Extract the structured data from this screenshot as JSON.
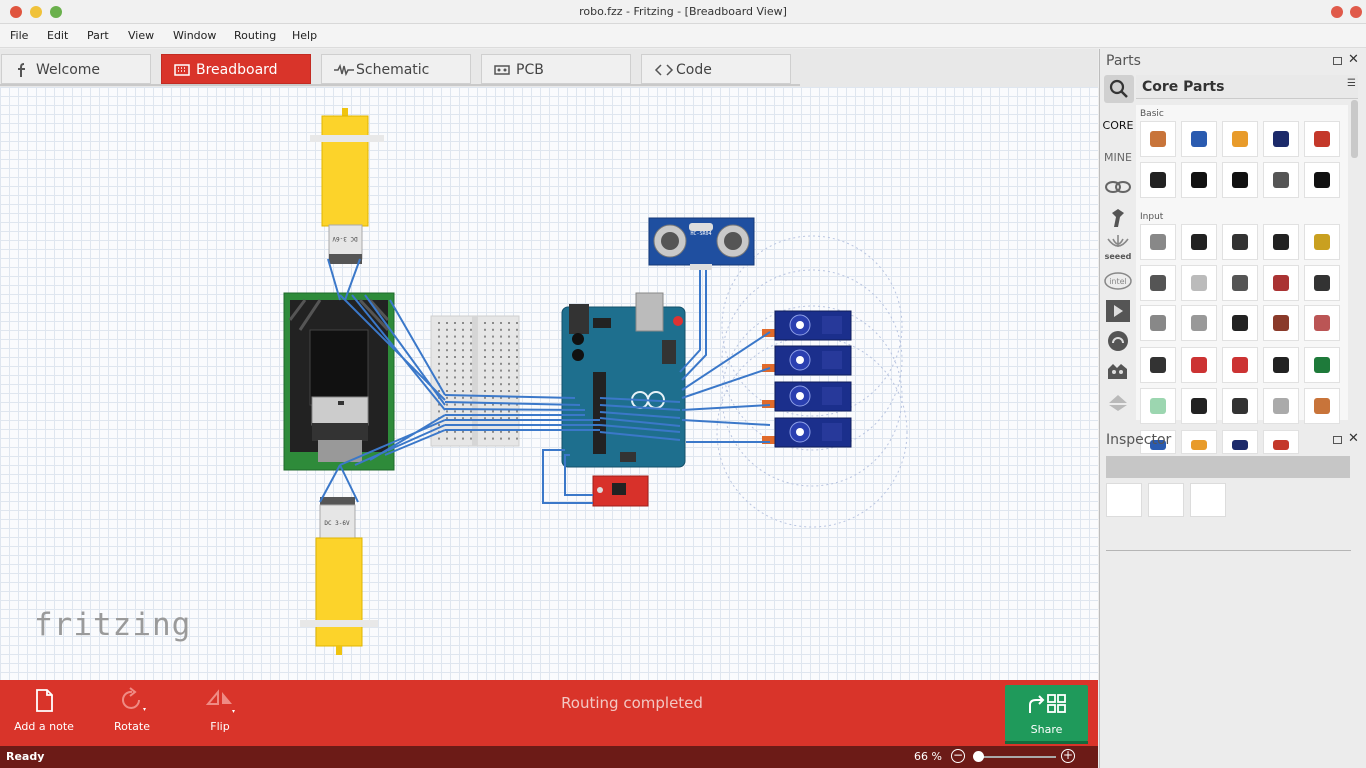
{
  "window": {
    "title": "robo.fzz - Fritzing - [Breadboard View]"
  },
  "menu": [
    "File",
    "Edit",
    "Part",
    "View",
    "Window",
    "Routing",
    "Help"
  ],
  "tabs": [
    {
      "label": "Welcome",
      "icon": "fritzing-f-icon",
      "active": false
    },
    {
      "label": "Breadboard",
      "icon": "breadboard-icon",
      "active": true
    },
    {
      "label": "Schematic",
      "icon": "schematic-icon",
      "active": false
    },
    {
      "label": "PCB",
      "icon": "pcb-icon",
      "active": false
    },
    {
      "label": "Code",
      "icon": "code-icon",
      "active": false
    }
  ],
  "canvas": {
    "logo": "fritzing",
    "motor_labels": [
      "DC 3-6V",
      "DC 3-6V"
    ],
    "sensor_label": "HC-SR04"
  },
  "toolbar": {
    "add_note": "Add a note",
    "rotate": "Rotate",
    "flip": "Flip",
    "status_message": "Routing completed",
    "share": "Share"
  },
  "statusbar": {
    "ready": "Ready",
    "zoom": "66 %"
  },
  "parts_panel": {
    "title": "Parts",
    "bin_title": "Core Parts",
    "bin_tabs": [
      "CORE",
      "MINE"
    ],
    "sections": [
      "Basic",
      "Input"
    ]
  },
  "inspector": {
    "title": "Inspector"
  },
  "colors": {
    "accent": "#d9342a",
    "share": "#1f9a5b",
    "status": "#6c1b17",
    "wire": "#3b78c9"
  }
}
